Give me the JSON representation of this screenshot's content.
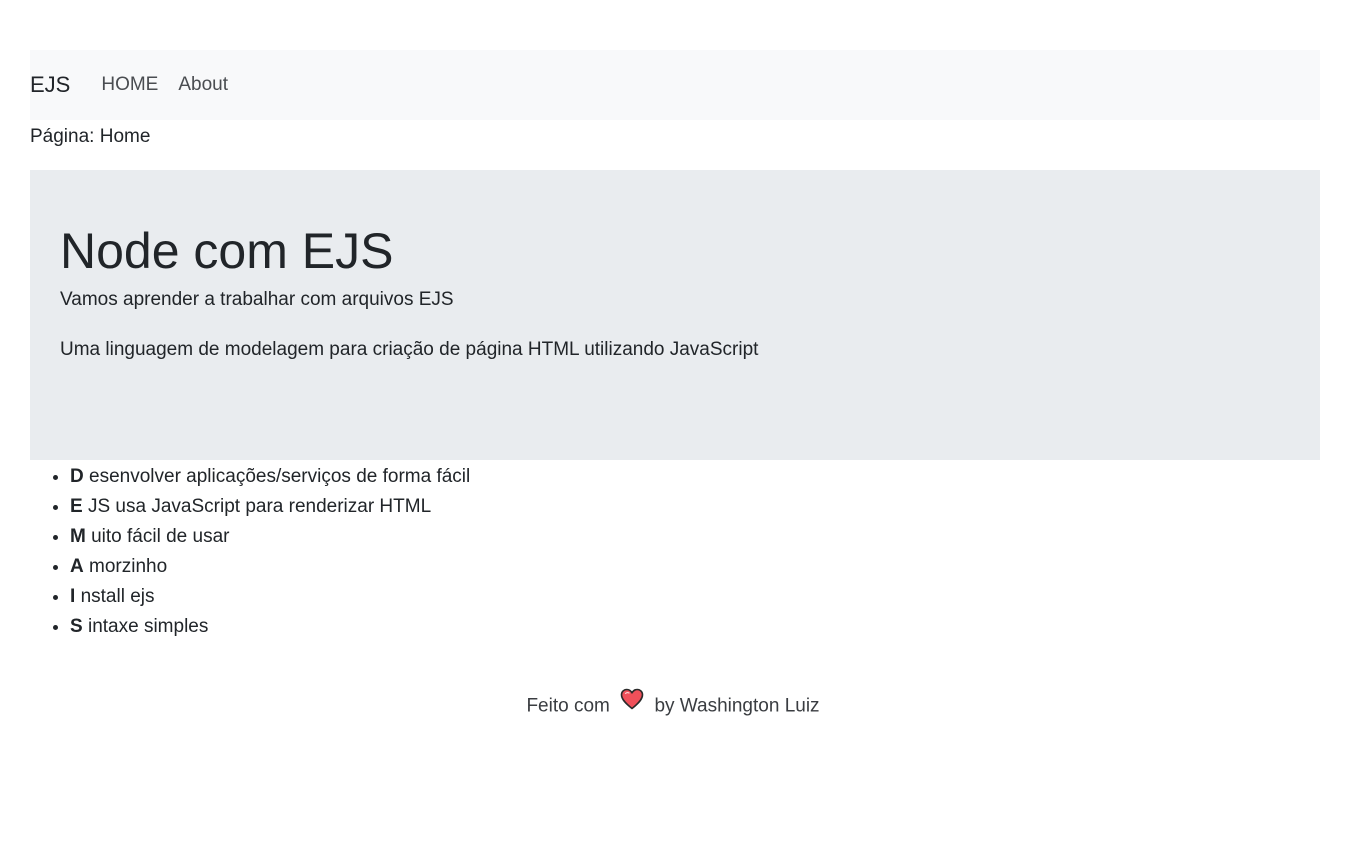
{
  "navbar": {
    "brand": "EJS",
    "links": [
      "HOME",
      "About"
    ]
  },
  "page": {
    "label": "Página: Home"
  },
  "jumbotron": {
    "title": "Node com EJS",
    "lead": "Vamos aprender a trabalhar com arquivos EJS",
    "description": "Uma linguagem de modelagem para criação de página HTML utilizando JavaScript"
  },
  "features": [
    {
      "letter": "D",
      "rest": "esenvolver aplicações/serviços de forma fácil"
    },
    {
      "letter": "E",
      "rest": "JS usa JavaScript para renderizar HTML"
    },
    {
      "letter": "M",
      "rest": "uito fácil de usar"
    },
    {
      "letter": "A",
      "rest": "morzinho"
    },
    {
      "letter": "I",
      "rest": "nstall ejs"
    },
    {
      "letter": "S",
      "rest": "intaxe simples"
    }
  ],
  "footer": {
    "prefix": "Feito com",
    "icon": "heart-icon",
    "suffix": "by Washington Luiz"
  },
  "colors": {
    "navbar_bg": "#f8f9fa",
    "jumbotron_bg": "#e9ecef",
    "heart": "#f0505a"
  }
}
